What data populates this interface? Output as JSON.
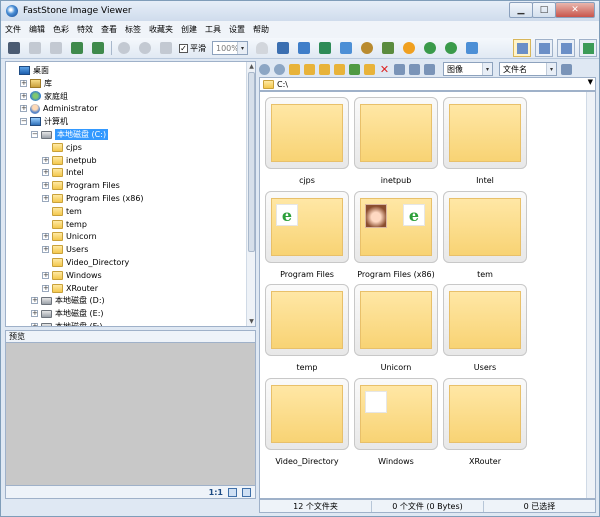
{
  "window": {
    "title": "FastStone Image Viewer"
  },
  "menu": [
    "文件",
    "编辑",
    "色彩",
    "特效",
    "查看",
    "标签",
    "收藏夹",
    "创建",
    "工具",
    "设置",
    "帮助"
  ],
  "toolbar": {
    "smooth_label": "平滑",
    "smooth_checked": true,
    "zoom_value": "100%"
  },
  "right_toolbar": {
    "view_mode": "图像",
    "sort_by": "文件名"
  },
  "tree": [
    {
      "label": "桌面",
      "icon": "desktop-icon",
      "level": 0,
      "expander": ""
    },
    {
      "label": "库",
      "icon": "library-icon",
      "level": 1,
      "expander": "+"
    },
    {
      "label": "家庭组",
      "icon": "homegroup-icon",
      "level": 1,
      "expander": "+"
    },
    {
      "label": "Administrator",
      "icon": "user-icon",
      "level": 1,
      "expander": "+"
    },
    {
      "label": "计算机",
      "icon": "computer-icon",
      "level": 1,
      "expander": "−"
    },
    {
      "label": "本地磁盘 (C:)",
      "icon": "drive-icon",
      "level": 2,
      "expander": "−",
      "selected": true
    },
    {
      "label": "cjps",
      "icon": "folder-icon",
      "level": 3,
      "expander": ""
    },
    {
      "label": "inetpub",
      "icon": "folder-icon",
      "level": 3,
      "expander": "+"
    },
    {
      "label": "Intel",
      "icon": "folder-icon",
      "level": 3,
      "expander": "+"
    },
    {
      "label": "Program Files",
      "icon": "folder-icon",
      "level": 3,
      "expander": "+"
    },
    {
      "label": "Program Files (x86)",
      "icon": "folder-icon",
      "level": 3,
      "expander": "+"
    },
    {
      "label": "tem",
      "icon": "folder-icon",
      "level": 3,
      "expander": ""
    },
    {
      "label": "temp",
      "icon": "folder-icon",
      "level": 3,
      "expander": ""
    },
    {
      "label": "Unicorn",
      "icon": "folder-icon",
      "level": 3,
      "expander": "+"
    },
    {
      "label": "Users",
      "icon": "folder-icon",
      "level": 3,
      "expander": "+"
    },
    {
      "label": "Video_Directory",
      "icon": "folder-icon",
      "level": 3,
      "expander": ""
    },
    {
      "label": "Windows",
      "icon": "folder-icon",
      "level": 3,
      "expander": "+"
    },
    {
      "label": "XRouter",
      "icon": "folder-icon",
      "level": 3,
      "expander": "+"
    },
    {
      "label": "本地磁盘 (D:)",
      "icon": "drive-icon",
      "level": 2,
      "expander": "+"
    },
    {
      "label": "本地磁盘 (E:)",
      "icon": "drive-icon",
      "level": 2,
      "expander": "+"
    },
    {
      "label": "本地磁盘 (F:)",
      "icon": "drive-icon",
      "level": 2,
      "expander": "+"
    }
  ],
  "preview": {
    "label": "预览",
    "zoom": "1:1"
  },
  "path": "C:\\",
  "thumbnails": [
    {
      "name": "cjps",
      "content": []
    },
    {
      "name": "inetpub",
      "content": []
    },
    {
      "name": "Intel",
      "content": []
    },
    {
      "name": "Program Files",
      "content": [
        "ie-icon"
      ]
    },
    {
      "name": "Program Files (x86)",
      "content": [
        "face-thumbnail",
        "ie-icon"
      ]
    },
    {
      "name": "tem",
      "content": []
    },
    {
      "name": "temp",
      "content": []
    },
    {
      "name": "Unicorn",
      "content": []
    },
    {
      "name": "Users",
      "content": []
    },
    {
      "name": "Video_Directory",
      "content": []
    },
    {
      "name": "Windows",
      "content": [
        "blank-file-icon"
      ]
    },
    {
      "name": "XRouter",
      "content": []
    }
  ],
  "status": {
    "folders": "12 个文件夹",
    "files": "0 个文件 (0 Bytes)",
    "selected": "0 已选择"
  }
}
